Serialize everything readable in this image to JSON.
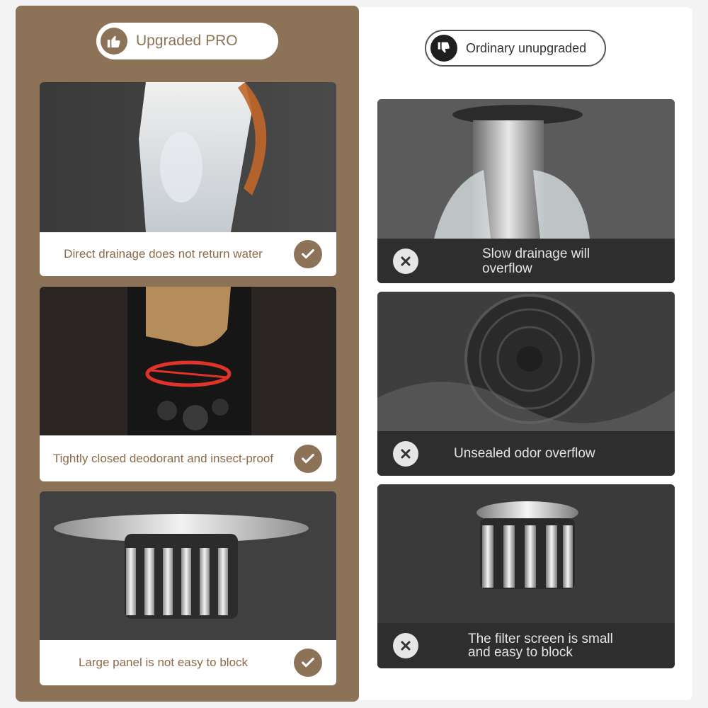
{
  "upgraded": {
    "badge": "Upgraded PRO",
    "badge_icon": "thumbs-up-icon",
    "accent": "#8c7358",
    "items": [
      {
        "caption": "Direct drainage does not return water",
        "icon": "check-icon"
      },
      {
        "caption": "Tightly closed deodorant and insect-proof",
        "icon": "check-icon"
      },
      {
        "caption": "Large panel is not easy to block",
        "icon": "check-icon"
      }
    ]
  },
  "ordinary": {
    "badge": "Ordinary unupgraded",
    "badge_icon": "thumbs-down-icon",
    "items": [
      {
        "caption_line1": "Slow drainage will",
        "caption_line2": "overflow",
        "icon": "x-icon"
      },
      {
        "caption_line1": "Unsealed odor overflow",
        "caption_line2": "",
        "icon": "x-icon"
      },
      {
        "caption_line1": "The filter screen is small",
        "caption_line2": "and easy to block",
        "icon": "x-icon"
      }
    ]
  }
}
